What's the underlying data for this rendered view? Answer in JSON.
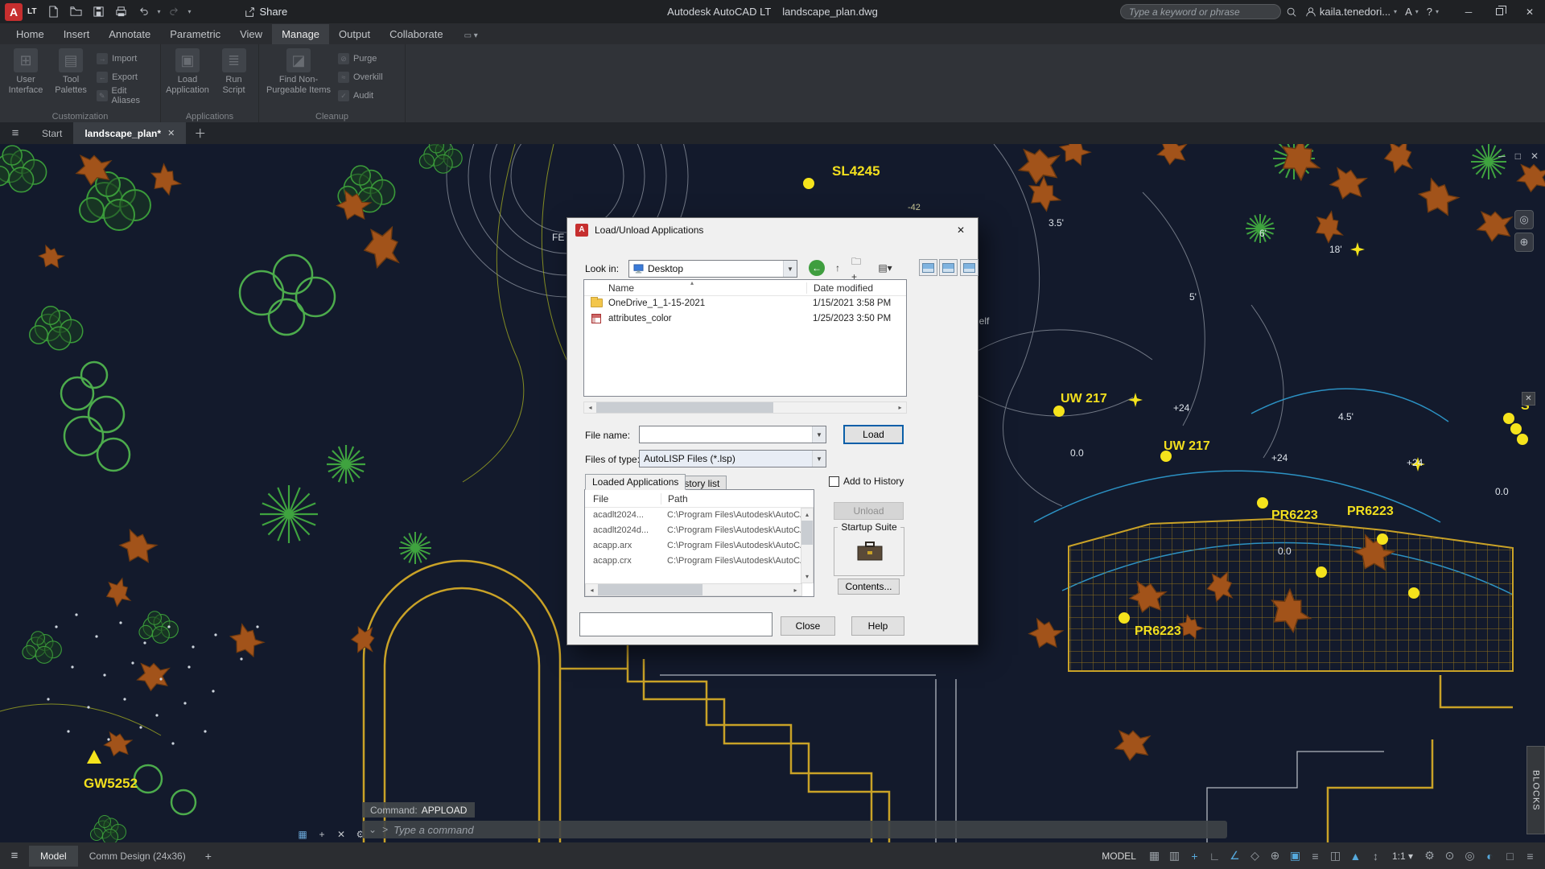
{
  "colors": {
    "accent_blue": "#56a9dc",
    "canvas_bg": "#131a2c",
    "cad_yellow": "#f2df1e",
    "cad_green": "#3a9a3a",
    "cad_orange": "#a2531a",
    "wall_yellow": "#c9a227",
    "cyan_line": "#2f9fd4",
    "app_red": "#c62f2f"
  },
  "titlebar": {
    "logo_letter": "A",
    "logo_badge": "LT",
    "share_label": "Share",
    "app_title": "Autodesk AutoCAD LT",
    "doc_title": "landscape_plan.dwg",
    "search_placeholder": "Type a keyword or phrase",
    "user_name": "kaila.tenedori...",
    "account_label": "A",
    "help_label": "?"
  },
  "ribbon": {
    "tabs": [
      {
        "label": "Home"
      },
      {
        "label": "Insert"
      },
      {
        "label": "Annotate"
      },
      {
        "label": "Parametric"
      },
      {
        "label": "View"
      },
      {
        "label": "Manage"
      },
      {
        "label": "Output"
      },
      {
        "label": "Collaborate"
      }
    ],
    "panels": {
      "customization": {
        "label": "Customization",
        "user_interface": "User Interface",
        "tool_palettes": "Tool Palettes",
        "import_label": "Import",
        "export_label": "Export",
        "edit_aliases": "Edit Aliases"
      },
      "applications": {
        "label": "Applications",
        "load_application": "Load Application",
        "run_script": "Run Script"
      },
      "cleanup": {
        "label": "Cleanup",
        "find_non_purgeable": "Find Non-Purgeable Items",
        "purge": "Purge",
        "overkill": "Overkill",
        "audit": "Audit"
      }
    }
  },
  "filetabs": {
    "start_tab": "Start",
    "active_tab": "landscape_plan*"
  },
  "dialog": {
    "title": "Load/Unload Applications",
    "look_in_label": "Look in:",
    "look_in_value": "Desktop",
    "browser": {
      "name_col": "Name",
      "date_col": "Date modified",
      "rows": [
        {
          "name": "OneDrive_1_1-15-2021",
          "date": "1/15/2021 3:58 PM"
        },
        {
          "name": "attributes_color",
          "date": "1/25/2023 3:50 PM"
        }
      ]
    },
    "file_name_label": "File name:",
    "file_name_value": "",
    "files_of_type_label": "Files of type:",
    "files_of_type_value": "AutoLISP Files (*.lsp)",
    "load_button": "Load",
    "loaded_tab": "Loaded Applications",
    "history_tab": "History list",
    "add_to_history_label": "Add to History",
    "table": {
      "file_col": "File",
      "path_col": "Path",
      "rows": [
        {
          "file": "acadlt2024...",
          "path": "C:\\Program Files\\Autodesk\\AutoCA..."
        },
        {
          "file": "acadlt2024d...",
          "path": "C:\\Program Files\\Autodesk\\AutoCA..."
        },
        {
          "file": "acapp.arx",
          "path": "C:\\Program Files\\Autodesk\\AutoCA..."
        },
        {
          "file": "acapp.crx",
          "path": "C:\\Program Files\\Autodesk\\AutoCA..."
        }
      ]
    },
    "unload_button": "Unload",
    "startup_suite_label": "Startup Suite",
    "contents_button": "Contents...",
    "close_button": "Close",
    "help_button": "Help"
  },
  "commandline": {
    "prompt_label": "Command:",
    "command_value": "APPLOAD",
    "input_placeholder": "Type a command"
  },
  "canvas": {
    "labels": [
      {
        "text": "SL4245"
      },
      {
        "text": "-42"
      },
      {
        "text": "FE"
      },
      {
        "text": "3.5'"
      },
      {
        "text": "6'"
      },
      {
        "text": "18'"
      },
      {
        "text": "5'"
      },
      {
        "text": "helf"
      },
      {
        "text": "UW 217"
      },
      {
        "text": "+24"
      },
      {
        "text": "UW 217"
      },
      {
        "text": "4.5'"
      },
      {
        "text": "0.0"
      },
      {
        "text": "+24"
      },
      {
        "text": "+24"
      },
      {
        "text": "0.0"
      },
      {
        "text": "PR6223"
      },
      {
        "text": "PR6223"
      },
      {
        "text": "0.0"
      },
      {
        "text": "PR6223"
      },
      {
        "text": "GW5252"
      },
      {
        "text": "S"
      }
    ],
    "blocks_tab": "BLOCKS"
  },
  "statusbar": {
    "model_tab": "Model",
    "layout_tab": "Comm Design (24x36)",
    "add_layout_label": "+",
    "space_label": "MODEL",
    "annotation_scale": "1:1",
    "icons": [
      "grid",
      "snap",
      "dynamic-input",
      "ortho",
      "polar-tracking",
      "isodraft",
      "object-snap-tracking",
      "object-snap",
      "lineweight",
      "selection-cycling",
      "annotation-visibility",
      "autoscale",
      "workspace-settings",
      "annotation-monitor",
      "isolate-objects",
      "graphics-performance",
      "clean-screen",
      "customize"
    ]
  }
}
